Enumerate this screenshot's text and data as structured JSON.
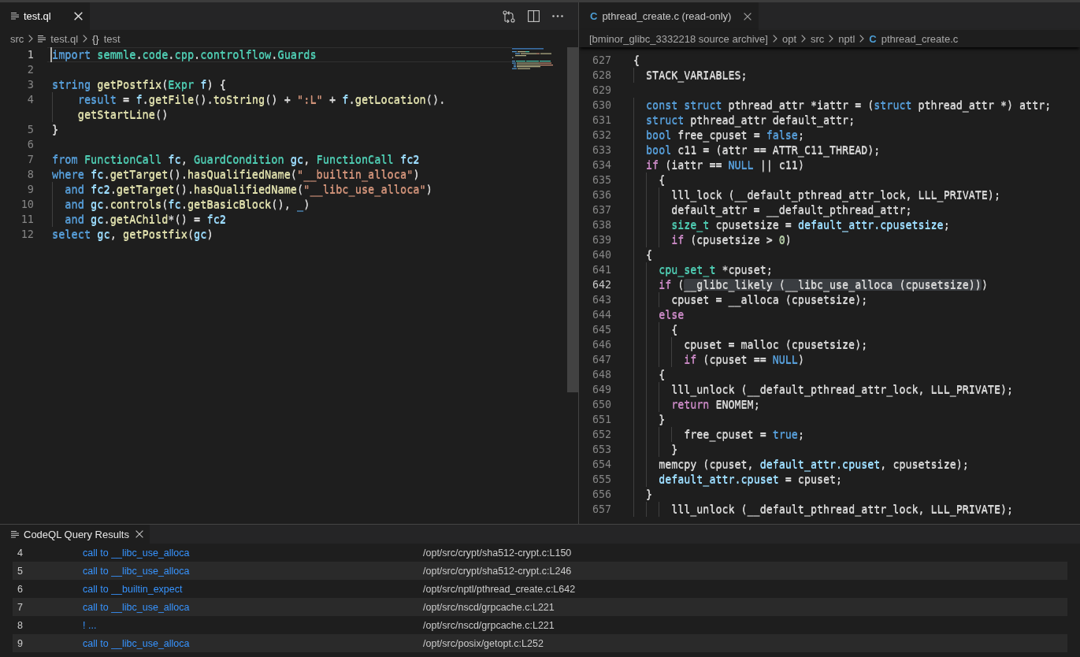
{
  "editor_groups": [
    {
      "focused": true,
      "scrolled": false,
      "tabs": [
        {
          "label": "test.ql",
          "selected": true
        }
      ],
      "breadcrumb": [
        {
          "kind": "folder",
          "label": "src"
        },
        {
          "kind": "file",
          "label": "test.ql"
        },
        {
          "kind": "symbol",
          "icon_text": "{}",
          "label": "test"
        }
      ],
      "lines": [
        {
          "number": "1",
          "current": true,
          "tokens": [
            {
              "kind": "keyword",
              "text": "import "
            },
            {
              "kind": "type",
              "text": "semmle"
            },
            {
              "kind": "plain",
              "text": "."
            },
            {
              "kind": "type",
              "text": "code"
            },
            {
              "kind": "plain",
              "text": "."
            },
            {
              "kind": "type",
              "text": "cpp"
            },
            {
              "kind": "plain",
              "text": "."
            },
            {
              "kind": "type",
              "text": "controlflow"
            },
            {
              "kind": "plain",
              "text": "."
            },
            {
              "kind": "type",
              "text": "Guards"
            }
          ]
        },
        {
          "number": "2",
          "current": false
        },
        {
          "number": "3",
          "current": false,
          "tokens": [
            {
              "kind": "keyword",
              "text": "string "
            },
            {
              "kind": "function",
              "text": "getPostfix"
            },
            {
              "kind": "plain",
              "text": "("
            },
            {
              "kind": "type",
              "text": "Expr "
            },
            {
              "kind": "variable",
              "text": "f"
            },
            {
              "kind": "plain",
              "text": ") {"
            }
          ]
        },
        {
          "number": "4",
          "current": false,
          "tokens": [
            {
              "kind": "keyword",
              "text": "    result"
            },
            {
              "kind": "plain",
              "text": " = "
            },
            {
              "kind": "variable",
              "text": "f"
            },
            {
              "kind": "plain",
              "text": "."
            },
            {
              "kind": "function",
              "text": "getFile"
            },
            {
              "kind": "plain",
              "text": "()."
            },
            {
              "kind": "function",
              "text": "toString"
            },
            {
              "kind": "plain",
              "text": "() + "
            },
            {
              "kind": "string",
              "text": "\":L\""
            },
            {
              "kind": "plain",
              "text": " + "
            },
            {
              "kind": "variable",
              "text": "f"
            },
            {
              "kind": "plain",
              "text": "."
            },
            {
              "kind": "function",
              "text": "getLocation"
            },
            {
              "kind": "plain",
              "text": "()."
            }
          ],
          "wrap": {
            "tokens": [
              {
                "kind": "function",
                "text": "    getStartLine"
              },
              {
                "kind": "plain",
                "text": "()"
              }
            ]
          }
        },
        {
          "number": "5",
          "current": false,
          "tokens": [
            {
              "kind": "plain",
              "text": "}"
            }
          ]
        },
        {
          "number": "6",
          "current": false
        },
        {
          "number": "7",
          "current": false,
          "tokens": [
            {
              "kind": "keyword",
              "text": "from "
            },
            {
              "kind": "type",
              "text": "FunctionCall "
            },
            {
              "kind": "variable",
              "text": "fc"
            },
            {
              "kind": "plain",
              "text": ", "
            },
            {
              "kind": "type",
              "text": "GuardCondition "
            },
            {
              "kind": "variable",
              "text": "gc"
            },
            {
              "kind": "plain",
              "text": ", "
            },
            {
              "kind": "type",
              "text": "FunctionCall "
            },
            {
              "kind": "variable",
              "text": "fc2"
            }
          ]
        },
        {
          "number": "8",
          "current": false,
          "tokens": [
            {
              "kind": "keyword",
              "text": "where "
            },
            {
              "kind": "variable",
              "text": "fc"
            },
            {
              "kind": "plain",
              "text": "."
            },
            {
              "kind": "function",
              "text": "getTarget"
            },
            {
              "kind": "plain",
              "text": "()."
            },
            {
              "kind": "function",
              "text": "hasQualifiedName"
            },
            {
              "kind": "plain",
              "text": "("
            },
            {
              "kind": "string",
              "text": "\"__builtin_alloca\""
            },
            {
              "kind": "plain",
              "text": ")"
            }
          ]
        },
        {
          "number": "9",
          "current": false,
          "tokens": [
            {
              "kind": "keyword",
              "text": "  and "
            },
            {
              "kind": "variable",
              "text": "fc2"
            },
            {
              "kind": "plain",
              "text": "."
            },
            {
              "kind": "function",
              "text": "getTarget"
            },
            {
              "kind": "plain",
              "text": "()."
            },
            {
              "kind": "function",
              "text": "hasQualifiedName"
            },
            {
              "kind": "plain",
              "text": "("
            },
            {
              "kind": "string",
              "text": "\"__libc_use_alloca\""
            },
            {
              "kind": "plain",
              "text": ")"
            }
          ]
        },
        {
          "number": "10",
          "current": false,
          "tokens": [
            {
              "kind": "keyword",
              "text": "  and "
            },
            {
              "kind": "variable",
              "text": "gc"
            },
            {
              "kind": "plain",
              "text": "."
            },
            {
              "kind": "function",
              "text": "controls"
            },
            {
              "kind": "plain",
              "text": "("
            },
            {
              "kind": "variable",
              "text": "fc"
            },
            {
              "kind": "plain",
              "text": "."
            },
            {
              "kind": "function",
              "text": "getBasicBlock"
            },
            {
              "kind": "plain",
              "text": "(), "
            },
            {
              "kind": "keyword",
              "text": "_"
            },
            {
              "kind": "plain",
              "text": ")"
            }
          ]
        },
        {
          "number": "11",
          "current": false,
          "tokens": [
            {
              "kind": "keyword",
              "text": "  and "
            },
            {
              "kind": "variable",
              "text": "gc"
            },
            {
              "kind": "plain",
              "text": "."
            },
            {
              "kind": "function",
              "text": "getAChild"
            },
            {
              "kind": "plain",
              "text": "*() = "
            },
            {
              "kind": "variable",
              "text": "fc2"
            }
          ]
        },
        {
          "number": "12",
          "current": false,
          "tokens": [
            {
              "kind": "keyword",
              "text": "select "
            },
            {
              "kind": "variable",
              "text": "gc"
            },
            {
              "kind": "plain",
              "text": ", "
            },
            {
              "kind": "function",
              "text": "getPostfix"
            },
            {
              "kind": "plain",
              "text": "("
            },
            {
              "kind": "variable",
              "text": "gc"
            },
            {
              "kind": "plain",
              "text": ")"
            }
          ]
        }
      ]
    },
    {
      "focused": false,
      "scrolled": true,
      "tabs": [
        {
          "label": "pthread_create.c (read-only)",
          "icon_text": "C",
          "selected": true
        }
      ],
      "breadcrumb": [
        {
          "kind": "folder",
          "label": "[bminor_glibc_3332218 source archive]"
        },
        {
          "kind": "folder",
          "label": "opt"
        },
        {
          "kind": "folder",
          "label": "src"
        },
        {
          "kind": "folder",
          "label": "nptl"
        },
        {
          "kind": "file",
          "icon_text": "C",
          "label": "pthread_create.c"
        }
      ],
      "lines": [
        {
          "number": "627",
          "current": false,
          "tokens": [
            {
              "kind": "plain",
              "text": "{"
            }
          ]
        },
        {
          "number": "628",
          "current": false,
          "tokens": [
            {
              "kind": "plain",
              "text": "  STACK_VARIABLES;"
            }
          ]
        },
        {
          "number": "629",
          "current": false
        },
        {
          "number": "630",
          "current": false,
          "tokens": [
            {
              "kind": "keyword",
              "text": "  const struct "
            },
            {
              "kind": "plain",
              "text": "pthread_attr *iattr = ("
            },
            {
              "kind": "keyword",
              "text": "struct "
            },
            {
              "kind": "plain",
              "text": "pthread_attr *) attr;"
            }
          ]
        },
        {
          "number": "631",
          "current": false,
          "tokens": [
            {
              "kind": "keyword",
              "text": "  struct "
            },
            {
              "kind": "plain",
              "text": "pthread_attr default_attr;"
            }
          ]
        },
        {
          "number": "632",
          "current": false,
          "tokens": [
            {
              "kind": "keyword",
              "text": "  bool "
            },
            {
              "kind": "plain",
              "text": "free_cpuset = "
            },
            {
              "kind": "keyword",
              "text": "false"
            },
            {
              "kind": "plain",
              "text": ";"
            }
          ]
        },
        {
          "number": "633",
          "current": false,
          "tokens": [
            {
              "kind": "keyword",
              "text": "  bool "
            },
            {
              "kind": "plain",
              "text": "c11 = (attr == ATTR_C11_THREAD);"
            }
          ]
        },
        {
          "number": "634",
          "current": false,
          "tokens": [
            {
              "kind": "control",
              "text": "  if "
            },
            {
              "kind": "plain",
              "text": "(iattr == "
            },
            {
              "kind": "keyword",
              "text": "NULL"
            },
            {
              "kind": "plain",
              "text": " || c11)"
            }
          ]
        },
        {
          "number": "635",
          "current": false,
          "tokens": [
            {
              "kind": "plain",
              "text": "    {"
            }
          ]
        },
        {
          "number": "636",
          "current": false,
          "tokens": [
            {
              "kind": "plain",
              "text": "      lll_lock (__default_pthread_attr_lock, LLL_PRIVATE);"
            }
          ]
        },
        {
          "number": "637",
          "current": false,
          "tokens": [
            {
              "kind": "plain",
              "text": "      default_attr = __default_pthread_attr;"
            }
          ]
        },
        {
          "number": "638",
          "current": false,
          "tokens": [
            {
              "kind": "type",
              "text": "      size_t "
            },
            {
              "kind": "plain",
              "text": "cpusetsize = "
            },
            {
              "kind": "variable",
              "text": "default_attr.cpusetsize"
            },
            {
              "kind": "plain",
              "text": ";"
            }
          ]
        },
        {
          "number": "639",
          "current": false,
          "tokens": [
            {
              "kind": "control",
              "text": "      if "
            },
            {
              "kind": "plain",
              "text": "(cpusetsize > "
            },
            {
              "kind": "number",
              "text": "0"
            },
            {
              "kind": "plain",
              "text": ")"
            }
          ]
        },
        {
          "number": "640",
          "current": false,
          "tokens": [
            {
              "kind": "plain",
              "text": "  {"
            }
          ]
        },
        {
          "number": "641",
          "current": false,
          "tokens": [
            {
              "kind": "type",
              "text": "    cpu_set_t "
            },
            {
              "kind": "plain",
              "text": "*cpuset;"
            }
          ]
        },
        {
          "number": "642",
          "current": true,
          "tokens": [
            {
              "kind": "control",
              "text": "    if "
            },
            {
              "kind": "plain",
              "text": "("
            },
            {
              "kind": "highlight",
              "text": "__glibc_likely (__libc_use_alloca (cpusetsize))"
            },
            {
              "kind": "plain",
              "text": ")"
            }
          ]
        },
        {
          "number": "643",
          "current": false,
          "tokens": [
            {
              "kind": "plain",
              "text": "      cpuset = __alloca (cpusetsize);"
            }
          ]
        },
        {
          "number": "644",
          "current": false,
          "tokens": [
            {
              "kind": "control",
              "text": "    else"
            }
          ]
        },
        {
          "number": "645",
          "current": false,
          "tokens": [
            {
              "kind": "plain",
              "text": "      {"
            }
          ]
        },
        {
          "number": "646",
          "current": false,
          "tokens": [
            {
              "kind": "plain",
              "text": "        cpuset = malloc (cpusetsize);"
            }
          ]
        },
        {
          "number": "647",
          "current": false,
          "tokens": [
            {
              "kind": "control",
              "text": "        if "
            },
            {
              "kind": "plain",
              "text": "(cpuset == "
            },
            {
              "kind": "keyword",
              "text": "NULL"
            },
            {
              "kind": "plain",
              "text": ")"
            }
          ]
        },
        {
          "number": "648",
          "current": false,
          "tokens": [
            {
              "kind": "plain",
              "text": "    {"
            }
          ]
        },
        {
          "number": "649",
          "current": false,
          "tokens": [
            {
              "kind": "plain",
              "text": "      lll_unlock (__default_pthread_attr_lock, LLL_PRIVATE);"
            }
          ]
        },
        {
          "number": "650",
          "current": false,
          "tokens": [
            {
              "kind": "control",
              "text": "      return "
            },
            {
              "kind": "plain",
              "text": "ENOMEM;"
            }
          ]
        },
        {
          "number": "651",
          "current": false,
          "tokens": [
            {
              "kind": "plain",
              "text": "    }"
            }
          ]
        },
        {
          "number": "652",
          "current": false,
          "tokens": [
            {
              "kind": "plain",
              "text": "        free_cpuset = "
            },
            {
              "kind": "keyword",
              "text": "true"
            },
            {
              "kind": "plain",
              "text": ";"
            }
          ]
        },
        {
          "number": "653",
          "current": false,
          "tokens": [
            {
              "kind": "plain",
              "text": "      }"
            }
          ]
        },
        {
          "number": "654",
          "current": false,
          "tokens": [
            {
              "kind": "plain",
              "text": "    memcpy (cpuset, "
            },
            {
              "kind": "variable",
              "text": "default_attr.cpuset"
            },
            {
              "kind": "plain",
              "text": ", cpusetsize);"
            }
          ]
        },
        {
          "number": "655",
          "current": false,
          "tokens": [
            {
              "kind": "variable",
              "text": "    default_attr.cpuset"
            },
            {
              "kind": "plain",
              "text": " = cpuset;"
            }
          ]
        },
        {
          "number": "656",
          "current": false,
          "tokens": [
            {
              "kind": "plain",
              "text": "  }"
            }
          ]
        },
        {
          "number": "657",
          "current": false,
          "tokens": [
            {
              "kind": "plain",
              "text": "      lll_unlock (__default_pthread_attr_lock, LLL_PRIVATE);"
            }
          ]
        }
      ]
    }
  ],
  "panel": {
    "tabs": [
      {
        "label": "CodeQL Query Results",
        "selected": true
      }
    ],
    "rows": [
      {
        "index": "4",
        "message": "call to __libc_use_alloca",
        "location": "/opt/src/crypt/sha512-crypt.c:L150"
      },
      {
        "index": "5",
        "message": "call to __libc_use_alloca",
        "location": "/opt/src/crypt/sha512-crypt.c:L246"
      },
      {
        "index": "6",
        "message": "call to __builtin_expect",
        "location": "/opt/src/nptl/pthread_create.c:L642"
      },
      {
        "index": "7",
        "message": "call to __libc_use_alloca",
        "location": "/opt/src/nscd/grpcache.c:L221"
      },
      {
        "index": "8",
        "message": "! ...",
        "location": "/opt/src/nscd/grpcache.c:L221"
      },
      {
        "index": "9",
        "message": "call to __libc_use_alloca",
        "location": "/opt/src/posix/getopt.c:L252"
      }
    ]
  }
}
